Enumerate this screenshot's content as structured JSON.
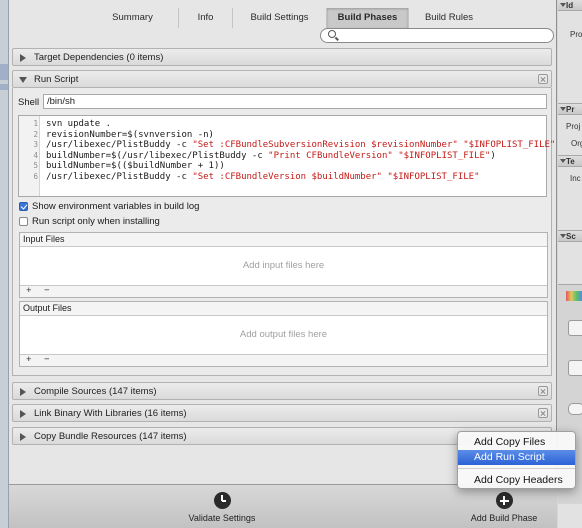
{
  "tabs": [
    {
      "label": "Summary",
      "active": false
    },
    {
      "label": "Info",
      "active": false
    },
    {
      "label": "Build Settings",
      "active": false
    },
    {
      "label": "Build Phases",
      "active": true
    },
    {
      "label": "Build Rules",
      "active": false
    }
  ],
  "search": {
    "value": "",
    "placeholder": ""
  },
  "phases": {
    "target_dependencies": "Target Dependencies (0 items)",
    "run_script": "Run Script",
    "compile_sources": "Compile Sources (147 items)",
    "link_binary": "Link Binary With Libraries (16 items)",
    "copy_bundle": "Copy Bundle Resources (147 items)"
  },
  "run_script": {
    "shell_label": "Shell",
    "shell_value": "/bin/sh",
    "script_lines": [
      {
        "n": "1",
        "pre": "svn update .",
        "str": "",
        "post": ""
      },
      {
        "n": "2",
        "pre": "revisionNumber=$(svnversion -n)",
        "str": "",
        "post": ""
      },
      {
        "n": "3",
        "pre": "/usr/libexec/PlistBuddy -c ",
        "str": "\"Set :CFBundleSubversionRevision $revisionNumber\" \"$INFOPLIST_FILE\"",
        "post": ""
      },
      {
        "n": "4",
        "pre": "buildNumber=$(/usr/libexec/PlistBuddy -c ",
        "str": "\"Print CFBundleVersion\" \"$INFOPLIST_FILE\"",
        "post": ")"
      },
      {
        "n": "5",
        "pre": "buildNumber=$(($buildNumber + 1))",
        "str": "",
        "post": ""
      },
      {
        "n": "6",
        "pre": "/usr/libexec/PlistBuddy -c ",
        "str": "\"Set :CFBundleVersion $buildNumber\" \"$INFOPLIST_FILE\"",
        "post": ""
      }
    ],
    "show_env_label": "Show environment variables in build log",
    "show_env_checked": true,
    "only_installing_label": "Run script only when installing",
    "only_installing_checked": false,
    "input_files": {
      "header": "Input Files",
      "empty": "Add input files here"
    },
    "output_files": {
      "header": "Output Files",
      "empty": "Add output files here"
    },
    "add_symbol": "+",
    "remove_symbol": "−"
  },
  "bottom_bar": {
    "validate": "Validate Settings",
    "add_phase": "Add Build Phase"
  },
  "menu": {
    "items": [
      "Add Copy Files",
      "Add Run Script",
      "Add Copy Headers"
    ],
    "highlighted": "Add Run Script"
  },
  "inspector": {
    "bars": [
      "Id",
      "Pr",
      "Te",
      "Sc"
    ],
    "labels": [
      "Pro",
      "Proj",
      "Org",
      "Inc"
    ]
  },
  "colors": {
    "selection": "#2c62d6",
    "string_literal": "#c41a16",
    "checkbox_on": "#3a76d8"
  }
}
